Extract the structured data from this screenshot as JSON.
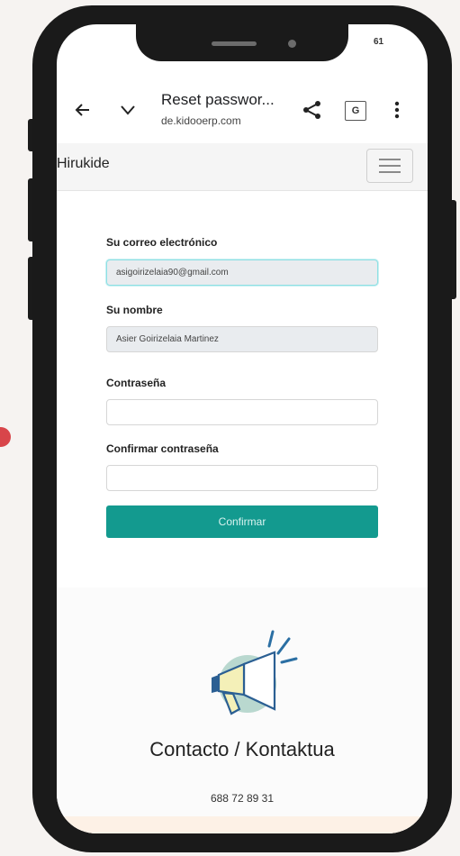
{
  "status_bar": {
    "time": "61"
  },
  "browser": {
    "back_icon": "arrow-left-icon",
    "tabs_icon": "chevron-down-icon",
    "title": "Reset passwor...",
    "url": "de.kidooerp.com",
    "share_icon": "share-icon",
    "translate_icon": "google-translate-icon",
    "menu_icon": "more-vert-icon"
  },
  "site": {
    "brand": "Hirukide",
    "menu_icon": "hamburger-icon"
  },
  "form": {
    "email_label": "Su correo electrónico",
    "email_value": "asigoirizelaia90@gmail.com",
    "name_label": "Su nombre",
    "name_value": "Asier Goirizelaia Martinez",
    "password_label": "Contraseña",
    "password_value": "",
    "confirm_label": "Confirmar contraseña",
    "confirm_value": "",
    "submit_label": "Confirmar"
  },
  "footer": {
    "icon": "megaphone-icon",
    "title": "Contacto / Kontaktua",
    "phone": "688 72 89 31"
  },
  "colors": {
    "accent": "#139a8f",
    "focus_border": "#8ee0e4",
    "readonly_bg": "#e9ecef",
    "phone_frame": "#1a1a1a",
    "decor_dot": "#d8454a"
  }
}
